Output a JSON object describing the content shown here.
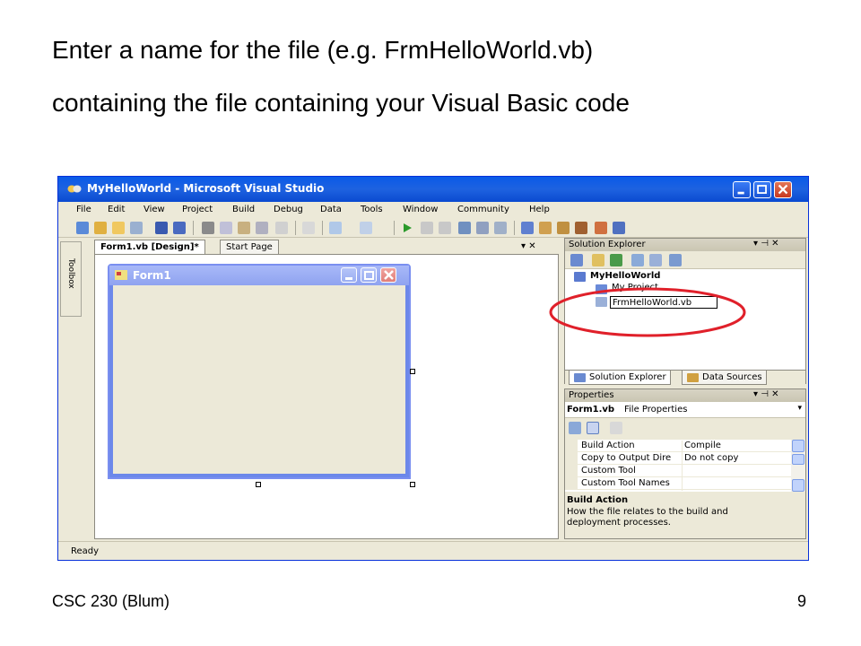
{
  "slide": {
    "line1": "Enter a name for the file (e.g. FrmHelloWorld.vb)",
    "line2": "containing the file containing your Visual Basic code",
    "footer_left": "CSC 230 (Blum)",
    "footer_right": "9"
  },
  "window": {
    "title": "MyHelloWorld - Microsoft Visual Studio",
    "menu": [
      "File",
      "Edit",
      "View",
      "Project",
      "Build",
      "Debug",
      "Data",
      "Tools",
      "Window",
      "Community",
      "Help"
    ],
    "status": "Ready"
  },
  "toolbox": {
    "label": "Toolbox"
  },
  "editor": {
    "tabs": [
      "Form1.vb [Design]*",
      "Start Page"
    ],
    "close_glyph": "▾ ✕",
    "form": {
      "title": "Form1"
    }
  },
  "solution_explorer": {
    "title": "Solution Explorer",
    "header_controls": "▾ ⊣ ✕",
    "project": "MyHelloWorld",
    "my_project": "My Project",
    "rename_value": "FrmHelloWorld.vb",
    "tabs": [
      "Solution Explorer",
      "Data Sources"
    ]
  },
  "properties": {
    "title": "Properties",
    "header_controls": "▾ ⊣ ✕",
    "object_name": "Form1.vb",
    "object_type": "File Properties",
    "rows": [
      {
        "name": "Build Action",
        "value": "Compile"
      },
      {
        "name": "Copy to Output Dire",
        "value": "Do not copy"
      },
      {
        "name": "Custom Tool",
        "value": ""
      },
      {
        "name": "Custom Tool Names",
        "value": ""
      }
    ],
    "desc_title": "Build Action",
    "desc_text": "How the file relates to the build and deployment processes."
  },
  "colors": {
    "titlebar": "#0a5ae8",
    "highlight_ellipse": "#e0202a",
    "form_border": "#7a8ff0"
  }
}
